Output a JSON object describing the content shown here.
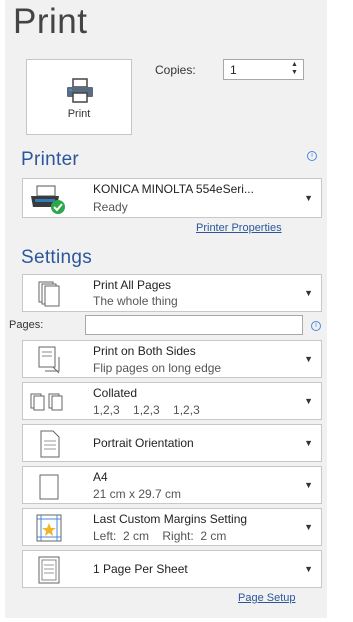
{
  "title": "Print",
  "print_button": {
    "label": "Print",
    "icon": "printer-icon"
  },
  "copies": {
    "label": "Copies:",
    "value": "1"
  },
  "printer": {
    "heading": "Printer",
    "name": "KONICA MINOLTA 554eSeri...",
    "status": "Ready",
    "properties_link": "Printer Properties"
  },
  "settings": {
    "heading": "Settings",
    "pages_label": "Pages:",
    "pages_value": "",
    "items": [
      {
        "line1": "Print All Pages",
        "line2": "The whole thing",
        "icon": "pages-icon"
      },
      {
        "line1": "Print on Both Sides",
        "line2": "Flip pages on long edge",
        "icon": "duplex-icon"
      },
      {
        "line1": "Collated",
        "line2": "1,2,3    1,2,3    1,2,3",
        "icon": "collate-icon"
      },
      {
        "line1": "Portrait Orientation",
        "line2": "",
        "icon": "portrait-icon"
      },
      {
        "line1": "A4",
        "line2": "21 cm x 29.7 cm",
        "icon": "paper-size-icon"
      },
      {
        "line1": "Last Custom Margins Setting",
        "line2": "Left:  2 cm    Right:  2 cm",
        "icon": "margins-icon"
      },
      {
        "line1": "1 Page Per Sheet",
        "line2": "",
        "icon": "pages-per-sheet-icon"
      }
    ],
    "page_setup_link": "Page Setup"
  },
  "colors": {
    "accent": "#2b579a",
    "panel": "#f1f1f1",
    "info": "#4a89dc"
  }
}
